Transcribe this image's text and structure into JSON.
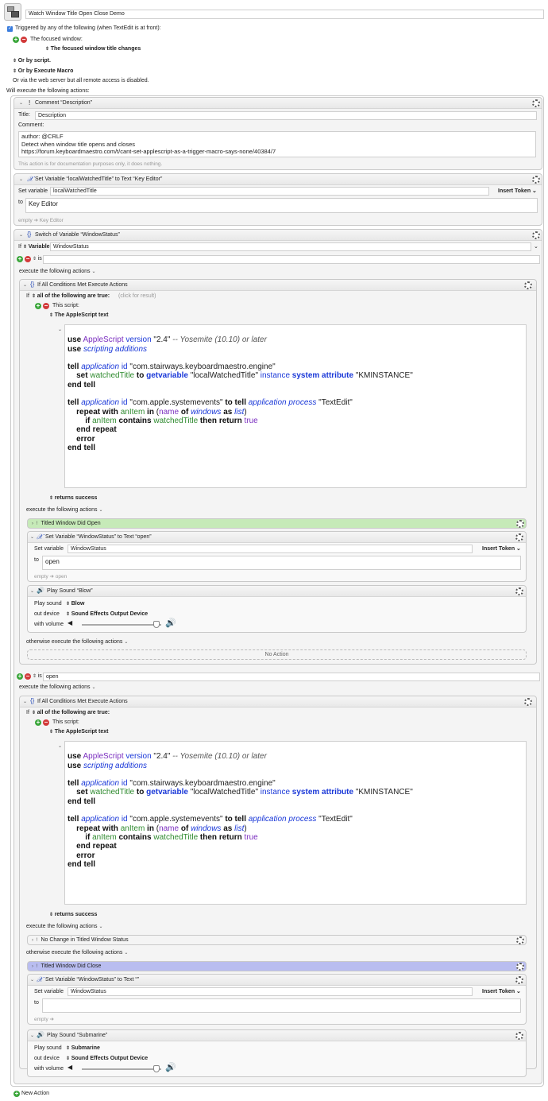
{
  "macro": {
    "title": "Watch Window Title Open Close Demo",
    "trigger_header": "Triggered by any of the following (when TextEdit is at front):",
    "trigger_1_label": "The focused window:",
    "trigger_1_value": "The focused window title changes",
    "or_script": "Or by script.",
    "or_execute": "Or by Execute Macro",
    "web_server": "Or via the web server but all remote access is disabled.",
    "will_execute": "Will execute the following actions:",
    "new_action": "New Action"
  },
  "comment_action": {
    "header": "Comment “Description”",
    "title_label": "Title:",
    "title_value": "Description",
    "comment_label": "Comment:",
    "lines": [
      "author: @CRLF",
      "Detect when window title opens and closes",
      "https://forum.keyboardmaestro.com/t/cant-set-applescript-as-a-trigger-macro-says-none/40384/7"
    ],
    "footer": "This action is for documentation purposes only, it does nothing."
  },
  "setvar_action": {
    "header": "Set Variable “localWatchedTitle” to Text “Key Editor”",
    "set_label": "Set variable",
    "var_value": "localWatchedTitle",
    "insert_token": "Insert Token",
    "to_label": "to",
    "to_value": "Key Editor",
    "preview": "empty ➔ Key Editor"
  },
  "switch_action": {
    "header": "Switch of Variable “WindowStatus”",
    "if_label": "If",
    "variable_label": "Variable",
    "variable_value": "WindowStatus",
    "case1_op": "is",
    "case1_value": "",
    "case2_op": "is",
    "case2_value": "open",
    "execute_label": "execute the following actions"
  },
  "ifall_1": {
    "header": "If All Conditions Met Execute Actions",
    "if_label": "If",
    "cond": "all of the following are true:",
    "click": "(click for result)",
    "this_script": "This script:",
    "script_type": "The AppleScript text",
    "returns": "returns success",
    "execute": "execute the following actions",
    "otherwise": "otherwise execute the following actions",
    "no_action": "No Action"
  },
  "actions_1": {
    "group": "Titled Window Did Open",
    "setvar_header": "Set Variable “WindowStatus” to Text “open”",
    "set_label": "Set variable",
    "var_value": "WindowStatus",
    "insert_token": "Insert Token",
    "to_label": "to",
    "to_value": "open",
    "preview": "empty ➔ open",
    "sound_header": "Play Sound “Blow”",
    "play_label": "Play sound",
    "sound_value": "Blow",
    "out_label": "out device",
    "out_value": "Sound Effects Output Device",
    "vol_label": "with volume"
  },
  "ifall_2": {
    "header": "If All Conditions Met Execute Actions",
    "if_label": "If",
    "cond": "all of the following are true:",
    "this_script": "This script:",
    "script_type": "The AppleScript text",
    "returns": "returns success",
    "execute": "execute the following actions",
    "otherwise": "otherwise execute the following actions"
  },
  "actions_2": {
    "nochange": "No Change in Titled Window Status",
    "group": "Titled Window Did Close",
    "setvar_header": "Set Variable “WindowStatus” to Text “”",
    "set_label": "Set variable",
    "var_value": "WindowStatus",
    "insert_token": "Insert Token",
    "to_label": "to",
    "to_value": "",
    "preview": "empty ➔",
    "sound_header": "Play Sound “Submarine”",
    "play_label": "Play sound",
    "sound_value": "Submarine",
    "out_label": "out device",
    "out_value": "Sound Effects Output Device",
    "vol_label": "with volume"
  },
  "script": {
    "l1": [
      "use",
      " AppleScript",
      " version",
      " \"2.4\"",
      " -- Yosemite (10.10) or later"
    ],
    "l2": [
      "use",
      " scripting additions"
    ],
    "l3": [
      "tell",
      " application",
      " id",
      " \"com.stairways.keyboardmaestro.engine\""
    ],
    "l4": [
      "set",
      " watchedTitle",
      " to",
      " getvariable",
      " \"localWatchedTitle\"",
      " instance",
      " system attribute",
      " \"KMINSTANCE\""
    ],
    "l5": [
      "end tell"
    ],
    "l6": [
      "tell",
      " application",
      " id",
      " \"com.apple.systemevents\"",
      " to tell",
      " application process",
      " \"TextEdit\""
    ],
    "l7": [
      "repeat with",
      " anItem",
      " in",
      " (",
      "name",
      " of",
      " windows",
      " as",
      " list",
      ")"
    ],
    "l8": [
      "if",
      " anItem",
      " contains",
      " watchedTitle",
      " then return",
      " true"
    ],
    "l9": [
      "end repeat"
    ],
    "l10": [
      "error"
    ],
    "l11": [
      "end tell"
    ]
  },
  "colors": {
    "green_group": "#c6eab8",
    "blue_group": "#b9bdf0",
    "keyword": "#111111",
    "app": "#7a2dbf",
    "class": "#1a38d8",
    "variable": "#2e8a2e"
  }
}
